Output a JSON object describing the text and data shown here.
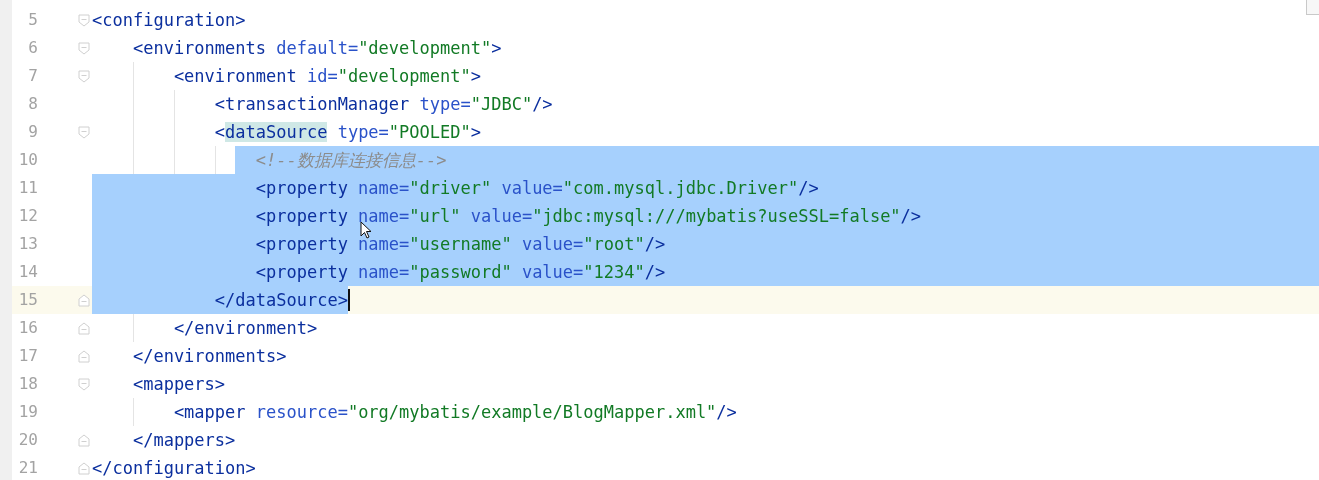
{
  "editor": {
    "lines": [
      {
        "number": "5",
        "fold_start": true,
        "fold_end": false,
        "selected": false,
        "current": false,
        "caret": false,
        "segments": [
          {
            "kind": "tag",
            "text": "<configuration>"
          }
        ],
        "children": [
          {
            "number": "6",
            "fold_start": true,
            "fold_end": false,
            "selected": false,
            "current": false,
            "caret": false,
            "segments": [
              {
                "kind": "tag",
                "text": "<environments"
              },
              {
                "kind": "attr",
                "text": " default="
              },
              {
                "kind": "value",
                "text": "\"development\""
              },
              {
                "kind": "tag",
                "text": ">"
              }
            ],
            "children": [
              {
                "number": "7",
                "fold_start": true,
                "fold_end": false,
                "selected": false,
                "current": false,
                "caret": false,
                "segments": [
                  {
                    "kind": "tag",
                    "text": "<environment"
                  },
                  {
                    "kind": "attr",
                    "text": " id="
                  },
                  {
                    "kind": "value",
                    "text": "\"development\""
                  },
                  {
                    "kind": "tag",
                    "text": ">"
                  }
                ],
                "children": [
                  {
                    "number": "8",
                    "fold_start": false,
                    "fold_end": false,
                    "selected": false,
                    "current": false,
                    "caret": false,
                    "segments": [
                      {
                        "kind": "tag",
                        "text": "<transactionManager"
                      },
                      {
                        "kind": "attr",
                        "text": " type="
                      },
                      {
                        "kind": "value",
                        "text": "\"JDBC\""
                      },
                      {
                        "kind": "tag",
                        "text": "/>"
                      }
                    ]
                  },
                  {
                    "number": "9",
                    "fold_start": true,
                    "fold_end": false,
                    "selected": false,
                    "current": false,
                    "caret": false,
                    "segments": [
                      {
                        "kind": "tag",
                        "text": "<"
                      },
                      {
                        "kind": "tag-matched",
                        "text": "dataSource"
                      },
                      {
                        "kind": "attr",
                        "text": " type="
                      },
                      {
                        "kind": "value",
                        "text": "\"POOLED\""
                      },
                      {
                        "kind": "tag",
                        "text": ">"
                      }
                    ],
                    "children": [
                      {
                        "number": "10",
                        "fold_start": false,
                        "fold_end": false,
                        "selected": true,
                        "current": false,
                        "caret": false,
                        "segments": [
                          {
                            "kind": "comment",
                            "text": "<!--数据库连接信息-->"
                          }
                        ]
                      },
                      {
                        "number": "11",
                        "fold_start": false,
                        "fold_end": false,
                        "selected": true,
                        "current": false,
                        "caret": false,
                        "segments": [
                          {
                            "kind": "tag",
                            "text": "<property"
                          },
                          {
                            "kind": "attr",
                            "text": " name="
                          },
                          {
                            "kind": "value",
                            "text": "\"driver\""
                          },
                          {
                            "kind": "attr",
                            "text": " value="
                          },
                          {
                            "kind": "value",
                            "text": "\"com.mysql.jdbc.Driver\""
                          },
                          {
                            "kind": "tag",
                            "text": "/>"
                          }
                        ]
                      },
                      {
                        "number": "12",
                        "fold_start": false,
                        "fold_end": false,
                        "selected": true,
                        "current": false,
                        "caret": false,
                        "segments": [
                          {
                            "kind": "tag",
                            "text": "<property"
                          },
                          {
                            "kind": "attr",
                            "text": " name="
                          },
                          {
                            "kind": "value",
                            "text": "\"url\""
                          },
                          {
                            "kind": "attr",
                            "text": " value="
                          },
                          {
                            "kind": "value",
                            "text": "\"jdbc:mysql:///mybatis?useSSL=false\""
                          },
                          {
                            "kind": "tag",
                            "text": "/>"
                          }
                        ]
                      },
                      {
                        "number": "13",
                        "fold_start": false,
                        "fold_end": false,
                        "selected": true,
                        "current": false,
                        "caret": false,
                        "segments": [
                          {
                            "kind": "tag",
                            "text": "<property"
                          },
                          {
                            "kind": "attr",
                            "text": " name="
                          },
                          {
                            "kind": "value",
                            "text": "\"username\""
                          },
                          {
                            "kind": "attr",
                            "text": " value="
                          },
                          {
                            "kind": "value",
                            "text": "\"root\""
                          },
                          {
                            "kind": "tag",
                            "text": "/>"
                          }
                        ]
                      },
                      {
                        "number": "14",
                        "fold_start": false,
                        "fold_end": false,
                        "selected": true,
                        "current": false,
                        "caret": false,
                        "segments": [
                          {
                            "kind": "tag",
                            "text": "<property"
                          },
                          {
                            "kind": "attr",
                            "text": " name="
                          },
                          {
                            "kind": "value",
                            "text": "\"password\""
                          },
                          {
                            "kind": "attr",
                            "text": " value="
                          },
                          {
                            "kind": "value",
                            "text": "\"1234\""
                          },
                          {
                            "kind": "tag",
                            "text": "/>"
                          }
                        ]
                      }
                    ]
                  },
                  {
                    "number": "15",
                    "fold_start": false,
                    "fold_end": true,
                    "selected": true,
                    "current": true,
                    "caret": true,
                    "segments": [
                      {
                        "kind": "tag",
                        "text": "</dataSource>"
                      }
                    ]
                  }
                ]
              },
              {
                "number": "16",
                "fold_start": false,
                "fold_end": true,
                "selected": false,
                "current": false,
                "caret": false,
                "segments": [
                  {
                    "kind": "tag",
                    "text": "</environment>"
                  }
                ]
              }
            ]
          },
          {
            "number": "17",
            "fold_start": false,
            "fold_end": true,
            "selected": false,
            "current": false,
            "caret": false,
            "segments": [
              {
                "kind": "tag",
                "text": "</environments>"
              }
            ]
          },
          {
            "number": "18",
            "fold_start": true,
            "fold_end": false,
            "selected": false,
            "current": false,
            "caret": false,
            "segments": [
              {
                "kind": "tag",
                "text": "<mappers>"
              }
            ],
            "children": [
              {
                "number": "19",
                "fold_start": false,
                "fold_end": false,
                "selected": false,
                "current": false,
                "caret": false,
                "segments": [
                  {
                    "kind": "tag",
                    "text": "<mapper"
                  },
                  {
                    "kind": "attr",
                    "text": " resource="
                  },
                  {
                    "kind": "value",
                    "text": "\"org/mybatis/example/BlogMapper.xml\""
                  },
                  {
                    "kind": "tag",
                    "text": "/>"
                  }
                ]
              }
            ]
          },
          {
            "number": "20",
            "fold_start": false,
            "fold_end": true,
            "selected": false,
            "current": false,
            "caret": false,
            "segments": [
              {
                "kind": "tag",
                "text": "</mappers>"
              }
            ]
          }
        ]
      },
      {
        "number": "21",
        "fold_start": false,
        "fold_end": true,
        "selected": false,
        "current": false,
        "caret": false,
        "segments": [
          {
            "kind": "tag",
            "text": "</configuration>"
          }
        ]
      }
    ]
  }
}
